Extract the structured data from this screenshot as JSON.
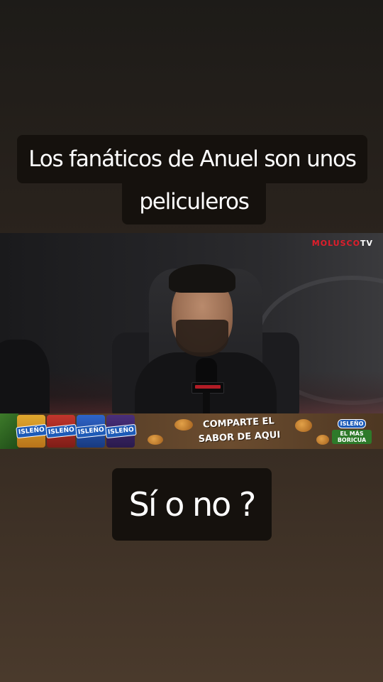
{
  "captions": {
    "line1": "Los fanáticos de Anuel son unos",
    "line2": "peliculeros",
    "question": "Sí o no ?"
  },
  "video": {
    "watermark_brand": "MOLUSCO",
    "watermark_suffix": "TV"
  },
  "ad": {
    "brand": "ISLEÑO",
    "slogan_line1": "COMPARTE EL",
    "slogan_line2": "SABOR DE AQUI",
    "tagline": "EL MÁS BORICUA"
  },
  "colors": {
    "caption_bg": "#15110d",
    "caption_text": "#ffffff",
    "watermark_red": "#e11d2b",
    "brand_blue": "#1e5bb8"
  }
}
